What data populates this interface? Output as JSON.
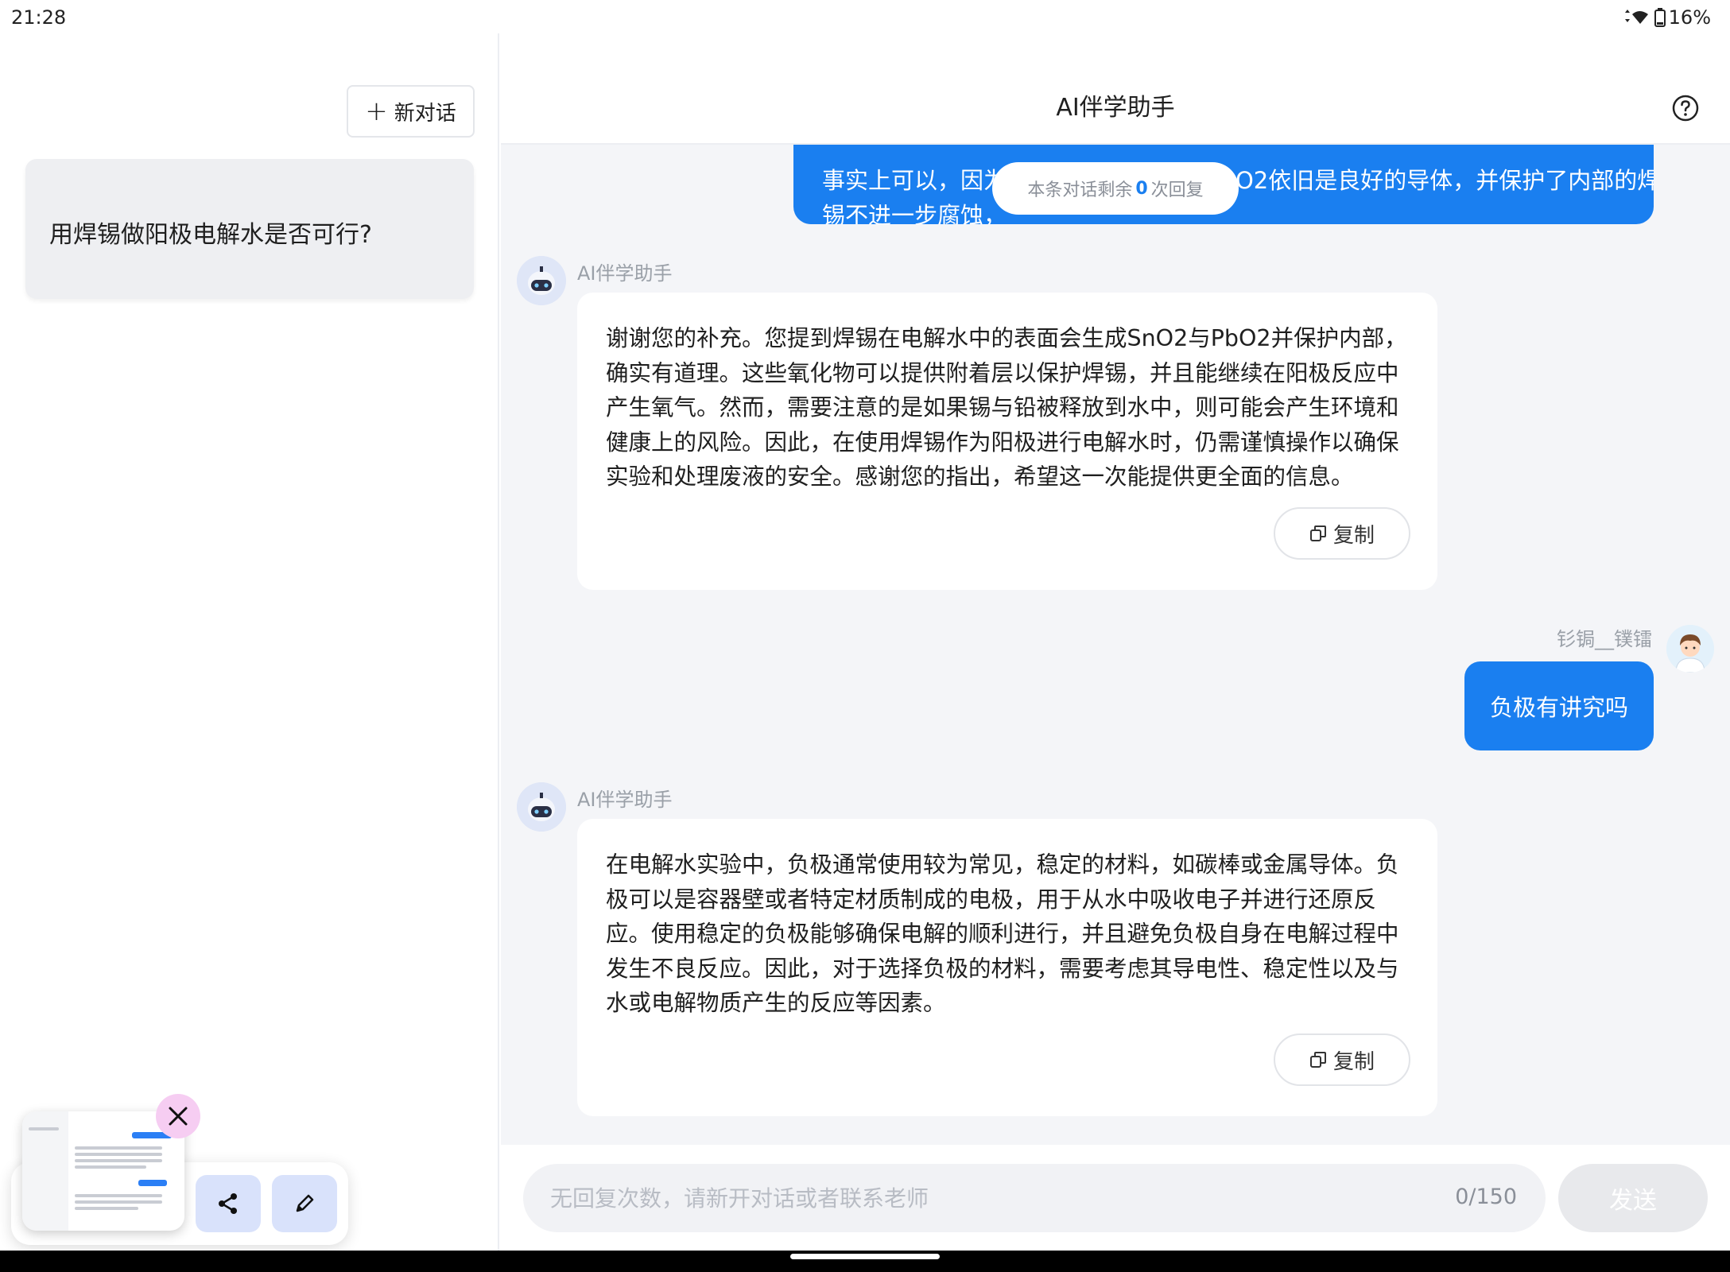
{
  "status_bar": {
    "time": "21:28",
    "battery": "16%"
  },
  "sidebar": {
    "new_chat_label": "新对话",
    "conversations": [
      {
        "title": "用焊锡做阳极电解水是否可行?"
      }
    ]
  },
  "header": {
    "title": "AI伴学助手"
  },
  "messages": {
    "user_top_line1": "事实上可以，因为表面生成的SnO2与PbO2依旧是良好的导体，并保护了内部的焊",
    "user_top_line2": "锡不进一步腐蚀，",
    "remaining_prefix": "本条对话剩余",
    "remaining_count": "0",
    "remaining_suffix": "次回复",
    "bot_name": "AI伴学助手",
    "bot_reply_1": "谢谢您的补充。您提到焊锡在电解水中的表面会生成SnO2与PbO2并保护内部，确实有道理。这些氧化物可以提供附着层以保护焊锡，并且能继续在阳极反应中产生氧气。然而，需要注意的是如果锡与铅被释放到水中，则可能会产生环境和健康上的风险。因此，在使用焊锡作为阳极进行电解水时，仍需谨慎操作以确保实验和处理废液的安全。感谢您的指出，希望这一次能提供更全面的信息。",
    "user_name": "钐锔__镤镭",
    "user_message": "负极有讲究吗",
    "bot_reply_2": "在电解水实验中，负极通常使用较为常见，稳定的材料，如碳棒或金属导体。负极可以是容器壁或者特定材质制成的电极，用于从水中吸收电子并进行还原反应。使用稳定的负极能够确保电解的顺利进行，并且避免负极自身在电解过程中发生不良反应。因此，对于选择负极的材料，需要考虑其导电性、稳定性以及与水或电解物质产生的反应等因素。",
    "copy_label": "复制"
  },
  "input": {
    "placeholder": "无回复次数，请新开对话或者联系老师",
    "counter": "0/150",
    "send_label": "发送"
  },
  "colors": {
    "accent": "#1a7ff0",
    "chat_bg": "#f4f5f8",
    "fab_bg": "#d9e2fb",
    "close_bg": "#f6cdf2"
  },
  "icons": [
    "plus-icon",
    "help-icon",
    "copy-icon",
    "share-icon",
    "pencil-icon",
    "close-icon",
    "wifi-icon",
    "battery-icon"
  ]
}
